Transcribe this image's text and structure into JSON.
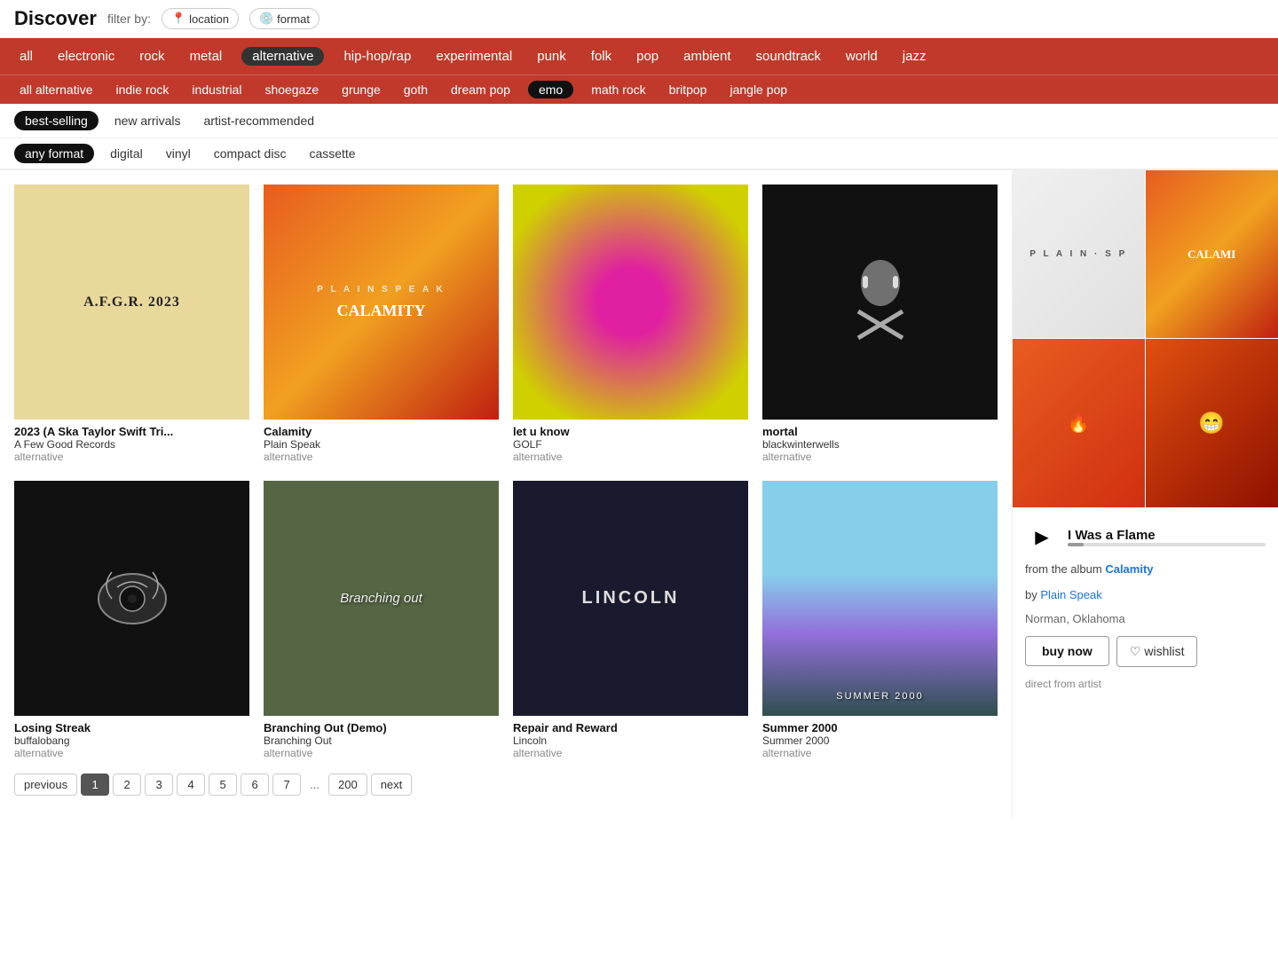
{
  "header": {
    "title": "Discover",
    "filter_label": "filter by:",
    "location_label": "location",
    "format_label": "format"
  },
  "genres": {
    "primary": [
      {
        "id": "all",
        "label": "all",
        "active": false
      },
      {
        "id": "electronic",
        "label": "electronic",
        "active": false
      },
      {
        "id": "rock",
        "label": "rock",
        "active": false
      },
      {
        "id": "metal",
        "label": "metal",
        "active": false
      },
      {
        "id": "alternative",
        "label": "alternative",
        "active": true
      },
      {
        "id": "hip-hop",
        "label": "hip-hop/rap",
        "active": false
      },
      {
        "id": "experimental",
        "label": "experimental",
        "active": false
      },
      {
        "id": "punk",
        "label": "punk",
        "active": false
      },
      {
        "id": "folk",
        "label": "folk",
        "active": false
      },
      {
        "id": "pop",
        "label": "pop",
        "active": false
      },
      {
        "id": "ambient",
        "label": "ambient",
        "active": false
      },
      {
        "id": "soundtrack",
        "label": "soundtrack",
        "active": false
      },
      {
        "id": "world",
        "label": "world",
        "active": false
      },
      {
        "id": "jazz",
        "label": "jazz",
        "active": false
      }
    ],
    "secondary": [
      {
        "id": "all-alt",
        "label": "all alternative",
        "active": false
      },
      {
        "id": "indie-rock",
        "label": "indie rock",
        "active": false
      },
      {
        "id": "industrial",
        "label": "industrial",
        "active": false
      },
      {
        "id": "shoegaze",
        "label": "shoegaze",
        "active": false
      },
      {
        "id": "grunge",
        "label": "grunge",
        "active": false
      },
      {
        "id": "goth",
        "label": "goth",
        "active": false
      },
      {
        "id": "dream-pop",
        "label": "dream pop",
        "active": false
      },
      {
        "id": "emo",
        "label": "emo",
        "active": true
      },
      {
        "id": "math-rock",
        "label": "math rock",
        "active": false
      },
      {
        "id": "britpop",
        "label": "britpop",
        "active": false
      },
      {
        "id": "jangle-pop",
        "label": "jangle pop",
        "active": false
      }
    ]
  },
  "sort": {
    "options": [
      {
        "id": "best-selling",
        "label": "best-selling",
        "active": true
      },
      {
        "id": "new-arrivals",
        "label": "new arrivals",
        "active": false
      },
      {
        "id": "artist-recommended",
        "label": "artist-recommended",
        "active": false
      }
    ]
  },
  "formats": {
    "options": [
      {
        "id": "any",
        "label": "any format",
        "active": true
      },
      {
        "id": "digital",
        "label": "digital",
        "active": false
      },
      {
        "id": "vinyl",
        "label": "vinyl",
        "active": false
      },
      {
        "id": "cd",
        "label": "compact disc",
        "active": false
      },
      {
        "id": "cassette",
        "label": "cassette",
        "active": false
      }
    ]
  },
  "albums": [
    {
      "id": 1,
      "title": "2023 (A Ska Taylor Swift Tri...",
      "artist": "A Few Good Records",
      "genre": "alternative",
      "art_type": "afgr",
      "art_text": "A.F.G.R. 2023"
    },
    {
      "id": 2,
      "title": "Calamity",
      "artist": "Plain Speak",
      "genre": "alternative",
      "art_type": "calamity",
      "art_text": "CALAMITY"
    },
    {
      "id": 3,
      "title": "let u know",
      "artist": "GOLF",
      "genre": "alternative",
      "art_type": "letuk",
      "art_text": ""
    },
    {
      "id": 4,
      "title": "mortal",
      "artist": "blackwinterwells",
      "genre": "alternative",
      "art_type": "mortal",
      "art_text": "✕"
    },
    {
      "id": 5,
      "title": "Losing Streak",
      "artist": "buffalobang",
      "genre": "alternative",
      "art_type": "losing",
      "art_text": "❊"
    },
    {
      "id": 6,
      "title": "Branching Out (Demo)",
      "artist": "Branching Out",
      "genre": "alternative",
      "art_type": "branching",
      "art_text": "Branching out"
    },
    {
      "id": 7,
      "title": "Repair and Reward",
      "artist": "Lincoln",
      "genre": "alternative",
      "art_type": "lincoln",
      "art_text": "LINCOLN"
    },
    {
      "id": 8,
      "title": "Summer 2000",
      "artist": "Summer 2000",
      "genre": "alternative",
      "art_type": "summer",
      "art_text": "SUMMER 2000"
    }
  ],
  "pagination": {
    "previous": "previous",
    "next": "next",
    "pages": [
      "1",
      "2",
      "3",
      "4",
      "5",
      "6",
      "7"
    ],
    "ellipsis": "...",
    "last": "200",
    "current": "1"
  },
  "right_panel": {
    "track_name": "I Was a Flame",
    "album_name": "Calamity",
    "artist_name": "Plain Speak",
    "location": "Norman, Oklahoma",
    "from_album_label": "from the album",
    "by_label": "by",
    "buy_label": "buy now",
    "wishlist_label": "wishlist",
    "direct_from_label": "direct from artist",
    "header_label": "P L A I N · S P"
  }
}
